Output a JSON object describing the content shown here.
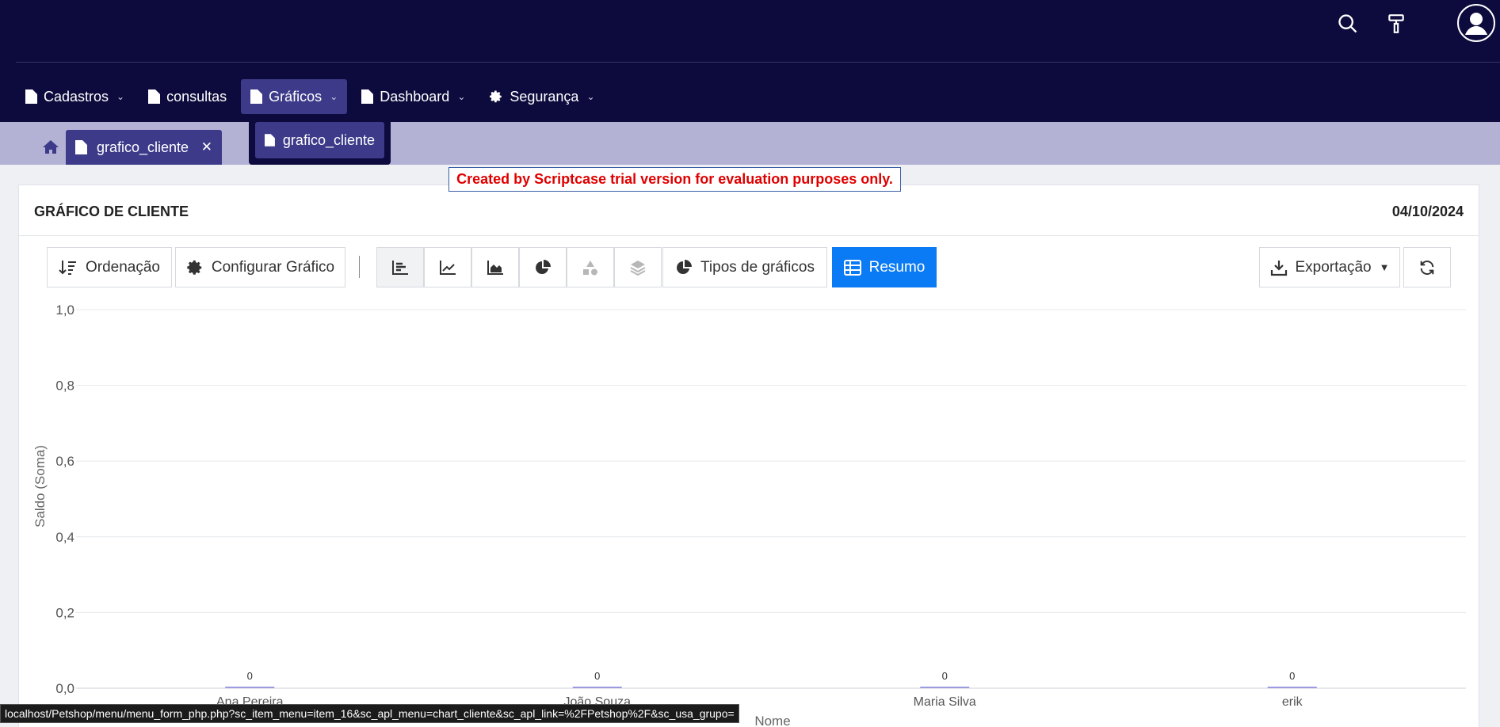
{
  "menu": {
    "items": [
      {
        "label": "Cadastros",
        "icon": "file-icon",
        "has_dropdown": true
      },
      {
        "label": "consultas",
        "icon": "file-icon",
        "has_dropdown": false
      },
      {
        "label": "Gráficos",
        "icon": "file-icon",
        "has_dropdown": true,
        "active": true
      },
      {
        "label": "Dashboard",
        "icon": "file-icon",
        "has_dropdown": true
      },
      {
        "label": "Segurança",
        "icon": "gear-icon",
        "has_dropdown": true
      }
    ],
    "dropdown_item": "grafico_cliente"
  },
  "tabs": {
    "active_label": "grafico_cliente"
  },
  "trial_notice": "Created by Scriptcase trial version for evaluation purposes only.",
  "panel": {
    "title": "GRÁFICO DE CLIENTE",
    "date": "04/10/2024"
  },
  "toolbar": {
    "sort_label": "Ordenação",
    "config_label": "Configurar Gráfico",
    "chart_types_label": "Tipos de gráficos",
    "summary_label": "Resumo",
    "export_label": "Exportação"
  },
  "status_url": "localhost/Petshop/menu/menu_form_php.php?sc_item_menu=item_16&sc_apl_menu=chart_cliente&sc_apl_link=%2FPetshop%2F&sc_usa_grupo=",
  "colors": {
    "nav_bg": "#0d0b3d",
    "accent": "#3d3a8a",
    "tabbar_bg": "#b3b1d4",
    "primary": "#0b7bf5",
    "bar": "#9d9be0"
  },
  "chart_data": {
    "type": "bar",
    "categories": [
      "Ana Pereira",
      "João Souza",
      "Maria Silva",
      "erik"
    ],
    "values": [
      0,
      0,
      0,
      0
    ],
    "data_labels": [
      "0",
      "0",
      "0",
      "0"
    ],
    "ylabel": "Saldo (Soma)",
    "xlabel": "Nome",
    "ylim": [
      0,
      1
    ],
    "yticks": [
      "0,0",
      "0,2",
      "0,4",
      "0,6",
      "0,8",
      "1,0"
    ],
    "grid": true
  }
}
